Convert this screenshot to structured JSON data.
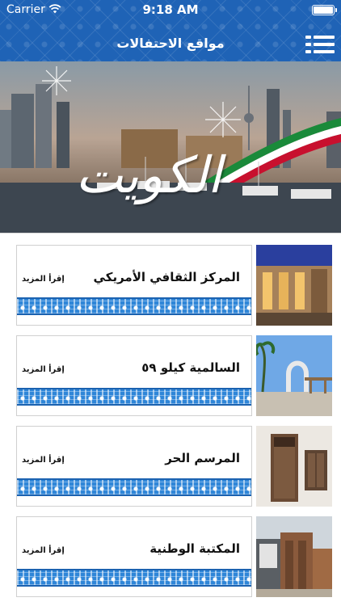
{
  "status_bar": {
    "carrier": "Carrier",
    "time": "9:18 AM"
  },
  "nav": {
    "title": "مواقع الاحتفالات",
    "menu_icon": "menu-icon"
  },
  "banner": {
    "text": "الكويت"
  },
  "places": [
    {
      "name": "المركز الثقافي الأمريكي",
      "more": "إقرأ المزيد"
    },
    {
      "name": "السالمية كيلو ٥٩",
      "more": "إقرأ المزيد"
    },
    {
      "name": "المرسم الحر",
      "more": "إقرأ المزيد"
    },
    {
      "name": "المكتبة الوطنية",
      "more": "إقرأ المزيد"
    }
  ],
  "colors": {
    "header": "#1f63b6",
    "ornament": "#2f86d8"
  }
}
